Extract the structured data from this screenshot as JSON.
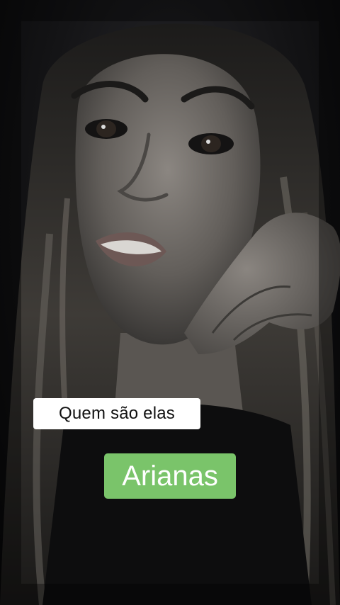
{
  "video": {
    "caption_line_1": "Quem são elas",
    "caption_line_2": "Arianas",
    "caption_line_1_bg": "#ffffff",
    "caption_line_2_bg": "#7ac46a"
  }
}
